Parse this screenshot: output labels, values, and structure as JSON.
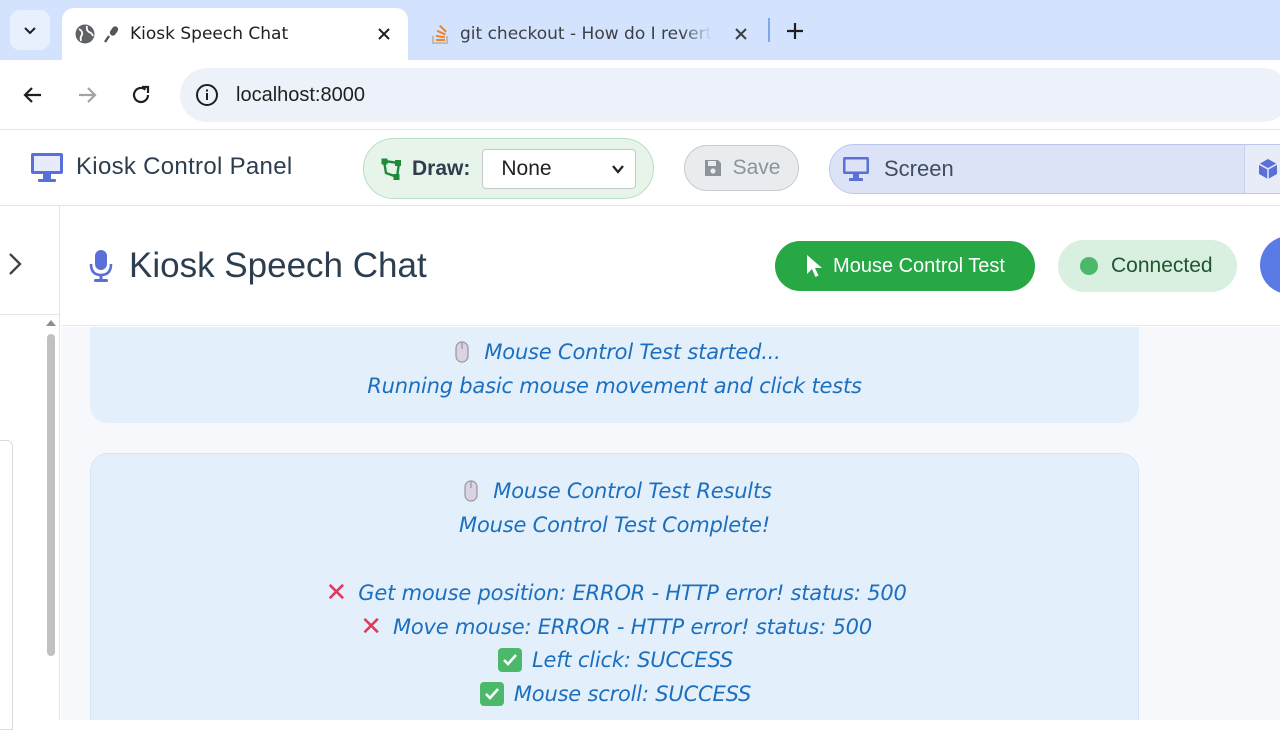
{
  "browser": {
    "tabs": [
      {
        "title": "Kiosk Speech Chat",
        "active": true
      },
      {
        "title": "git checkout - How do I revert a",
        "active": false
      }
    ],
    "url": "localhost:8000"
  },
  "app": {
    "brand": "Kiosk Control Panel",
    "draw_label": "Draw:",
    "draw_selected": "None",
    "save_label": "Save",
    "screen_label": "Screen"
  },
  "chat": {
    "title": "Kiosk Speech Chat",
    "mouse_test_button": "Mouse Control Test",
    "status": "Connected",
    "messages": [
      {
        "line1": "Mouse Control Test started...",
        "line2": "Running basic mouse movement and click tests"
      },
      {
        "line1": "Mouse Control Test Results",
        "line2": "Mouse Control Test Complete!",
        "results": [
          {
            "status": "error",
            "text": "Get mouse position: ERROR - HTTP error! status: 500"
          },
          {
            "status": "error",
            "text": "Move mouse: ERROR - HTTP error! status: 500"
          },
          {
            "status": "success",
            "text": "Left click: SUCCESS"
          },
          {
            "status": "success",
            "text": "Mouse scroll: SUCCESS"
          }
        ]
      }
    ]
  },
  "colors": {
    "accent_green": "#28a745",
    "message_bg": "#e3f0fc",
    "message_text": "#1c6fbf",
    "brand_blue": "#5a6fd8"
  }
}
